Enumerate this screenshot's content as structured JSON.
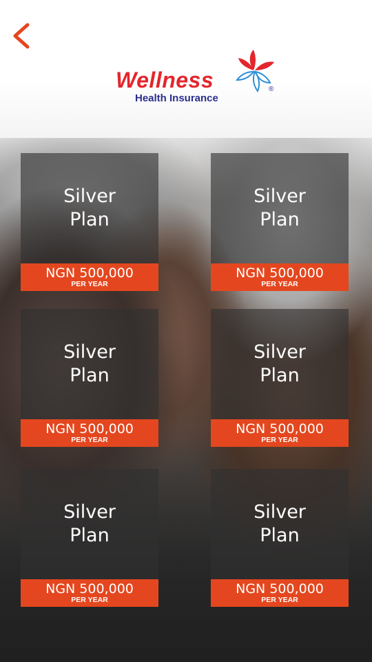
{
  "header": {
    "back_icon": "chevron-left-icon",
    "accent_color": "#e4471f",
    "logo": {
      "brand": "Wellness",
      "tagline": "Health Insurance",
      "registered": "®",
      "brand_color": "#e3262c",
      "tagline_color": "#2b2f8e"
    }
  },
  "plans": [
    {
      "name_line1": "Silver",
      "name_line2": "Plan",
      "price": "NGN 500,000",
      "period": "PER YEAR"
    },
    {
      "name_line1": "Silver",
      "name_line2": "Plan",
      "price": "NGN 500,000",
      "period": "PER YEAR"
    },
    {
      "name_line1": "Silver",
      "name_line2": "Plan",
      "price": "NGN 500,000",
      "period": "PER YEAR"
    },
    {
      "name_line1": "Silver",
      "name_line2": "Plan",
      "price": "NGN 500,000",
      "period": "PER YEAR"
    },
    {
      "name_line1": "Silver",
      "name_line2": "Plan",
      "price": "NGN 500,000",
      "period": "PER YEAR"
    },
    {
      "name_line1": "Silver",
      "name_line2": "Plan",
      "price": "NGN 500,000",
      "period": "PER YEAR"
    }
  ]
}
